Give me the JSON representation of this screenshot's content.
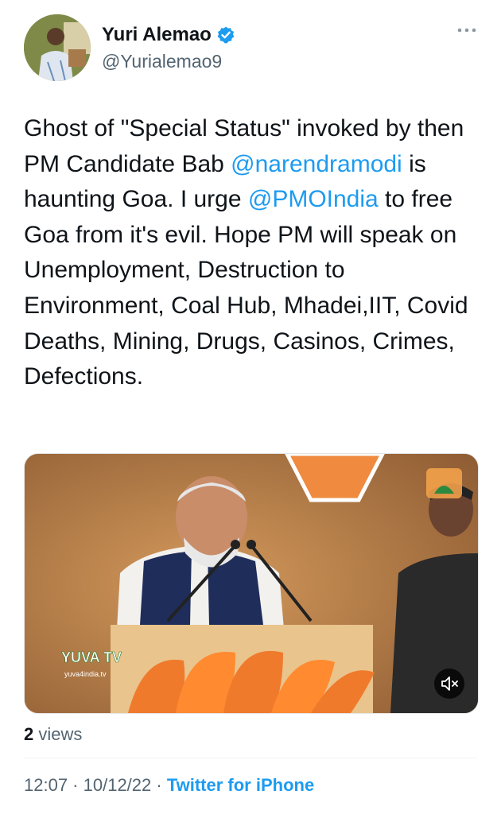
{
  "author": {
    "display_name": "Yuri Alemao",
    "handle": "@Yurialemao9",
    "verified": true
  },
  "tweet": {
    "segments": [
      {
        "type": "text",
        "value": "Ghost of \"Special Status\" invoked by then PM Candidate Bab "
      },
      {
        "type": "mention",
        "value": "@narendramodi"
      },
      {
        "type": "text",
        "value": " is haunting Goa. I urge "
      },
      {
        "type": "mention",
        "value": "@PMOIndia"
      },
      {
        "type": "text",
        "value": " to free Goa from it's evil. Hope PM will speak on Unemployment, Destruction to Environment, Coal Hub, Mhadei,IIT, Covid Deaths, Mining, Drugs, Casinos, Crimes, Defections."
      }
    ]
  },
  "media": {
    "watermark_logo": "YUVA TV",
    "watermark_url": "yuva4india.tv",
    "mute_icon": "speaker-muted-icon"
  },
  "stats": {
    "views_count": "2",
    "views_label": " views"
  },
  "meta": {
    "time": "12:07",
    "separator": " · ",
    "date": "10/12/22",
    "source": "Twitter for iPhone"
  },
  "colors": {
    "accent": "#1d9bf0",
    "text_primary": "#0f1419",
    "text_secondary": "#536471"
  }
}
